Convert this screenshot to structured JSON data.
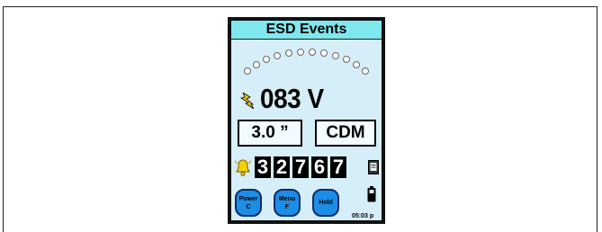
{
  "screen": {
    "title": "ESD Events",
    "voltage": "083 V",
    "distance": "3.0 ”",
    "mode": "CDM",
    "counter_digits": [
      "3",
      "2",
      "7",
      "6",
      "7"
    ],
    "clock": "05:03 p",
    "buttons": {
      "power": {
        "line1": "Power",
        "line2": "C"
      },
      "menu": {
        "line1": "Menu",
        "line2": "F"
      },
      "hold": {
        "line1": "Hold"
      }
    },
    "gauge_segments_lit": 0,
    "gauge_segments_total": 11
  },
  "icons": {
    "bolt": "lightning-icon",
    "bell": "alarm-bell-icon",
    "document": "document-icon",
    "battery": "battery-icon"
  },
  "colors": {
    "title_bar": "#7fe8ef",
    "screen_bg": "#d6eef8",
    "button": "#1e8de6",
    "bolt": "#f0c800"
  }
}
